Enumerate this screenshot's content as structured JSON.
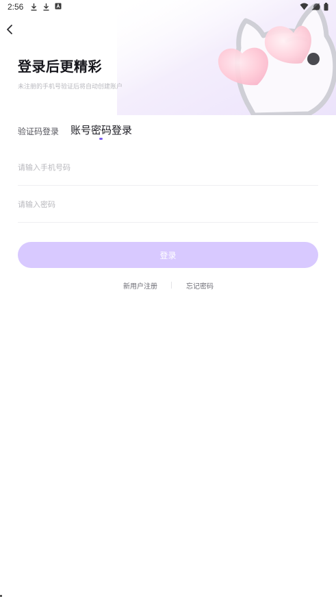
{
  "status_bar": {
    "time": "2:56",
    "icons": [
      "download-icon",
      "download-icon",
      "accessibility-icon",
      "wifi-icon",
      "signal-icon",
      "battery-icon"
    ]
  },
  "header": {
    "back_icon": "chevron-left-icon",
    "title": "登录后更精彩",
    "subtitle": "未注册的手机号验证后将自动创建账户"
  },
  "tabs": [
    {
      "label": "验证码登录",
      "active": false
    },
    {
      "label": "账号密码登录",
      "active": true
    }
  ],
  "form": {
    "phone_placeholder": "请输入手机号码",
    "phone_value": "",
    "password_placeholder": "请输入密码",
    "password_value": ""
  },
  "login_button": {
    "label": "登录"
  },
  "links": {
    "register": "新用户注册",
    "forgot_password": "忘记密码"
  },
  "colors": {
    "accent": "#7a5cf0",
    "button_bg": "#d8c9ff",
    "placeholder": "#b8b8bd",
    "title": "#16161c"
  }
}
